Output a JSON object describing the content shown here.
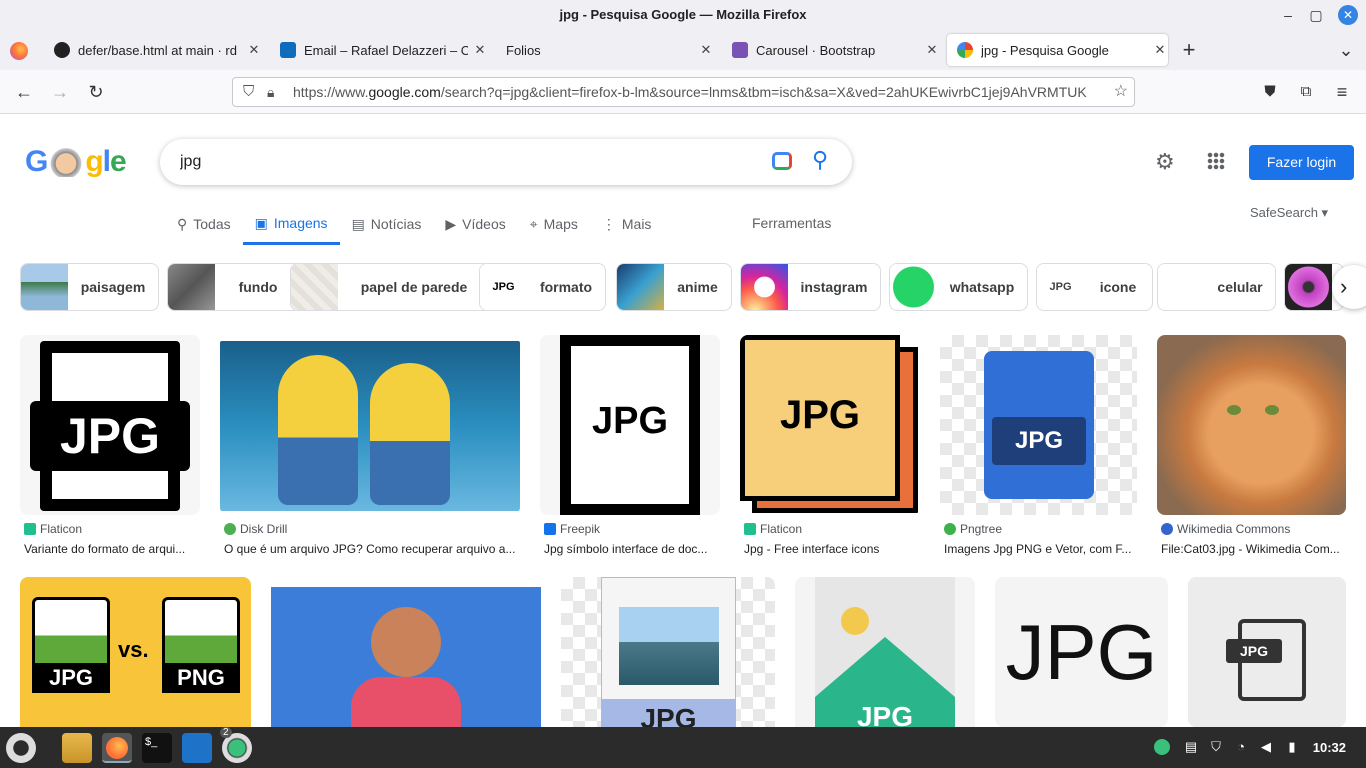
{
  "window": {
    "title": "jpg - Pesquisa Google — Mozilla Firefox",
    "minimize": "–",
    "maximize": "▢",
    "close": "✕"
  },
  "tabs": [
    {
      "label": "defer/base.html at main · rd",
      "icon": "github-icon",
      "close": "✕"
    },
    {
      "label": "Email – Rafael Delazzeri – O",
      "icon": "outlook-icon",
      "close": "✕"
    },
    {
      "label": "Folios",
      "icon": "",
      "close": "✕"
    },
    {
      "label": "Carousel · Bootstrap",
      "icon": "bootstrap-icon",
      "close": "✕"
    },
    {
      "label": "jpg - Pesquisa Google",
      "icon": "google-icon",
      "close": "✕"
    }
  ],
  "nav": {
    "new_tab": "+",
    "tab_list": "⌄",
    "back": "←",
    "forward": "→",
    "reload": "↻",
    "menu": "≡",
    "url_prefix": "https://www.",
    "url_host": "google.com",
    "url_rest": "/search?q=jpg&client=firefox-b-lm&source=lnms&tbm=isch&sa=X&ved=2ahUKEwivrbC1jej9AhVRMTUK"
  },
  "google": {
    "logo": "Google",
    "query": "jpg",
    "login": "Fazer login",
    "safesearch": "SafeSearch ▾",
    "tools": "Ferramentas",
    "tabs": [
      {
        "label": "Todas",
        "icon": "search-icon",
        "glyph": "⚲"
      },
      {
        "label": "Imagens",
        "icon": "image-icon",
        "glyph": "▣"
      },
      {
        "label": "Notícias",
        "icon": "news-icon",
        "glyph": "▤"
      },
      {
        "label": "Vídeos",
        "icon": "video-icon",
        "glyph": "▶"
      },
      {
        "label": "Maps",
        "icon": "map-pin-icon",
        "glyph": "⌖"
      },
      {
        "label": "Mais",
        "icon": "more-icon",
        "glyph": "⋮"
      }
    ],
    "chips": [
      "paisagem",
      "fundo",
      "papel de parede",
      "formato",
      "anime",
      "instagram",
      "whatsapp",
      "icone",
      "celular"
    ],
    "chip_next": "›",
    "results": [
      {
        "source": "Flaticon",
        "title": "Variante do formato de arqui...",
        "img_text": "JPG"
      },
      {
        "source": "Disk Drill",
        "title": "O que é um arquivo JPG? Como recuperar arquivo a...",
        "img_text": ""
      },
      {
        "source": "Freepik",
        "title": "Jpg símbolo interface de doc...",
        "img_text": "JPG"
      },
      {
        "source": "Flaticon",
        "title": "Jpg - Free interface icons",
        "img_text": "JPG"
      },
      {
        "source": "Pngtree",
        "title": "Imagens Jpg PNG e Vetor, com F...",
        "img_text": "JPG"
      },
      {
        "source": "Wikimedia Commons",
        "title": "File:Cat03.jpg - Wikimedia Com...",
        "img_text": ""
      }
    ],
    "row2": [
      {
        "t1": "JPG",
        "t2": "vs.",
        "t3": "PNG"
      },
      {
        "t1": ""
      },
      {
        "t1": "JPG"
      },
      {
        "t1": "JPG"
      },
      {
        "t1": "JPG"
      },
      {
        "t1": "JPG"
      }
    ]
  },
  "taskbar": {
    "clock": "10:32",
    "badge": "2"
  },
  "colors": {
    "accent": "#1a73e8",
    "taskbar": "#2b2b2b",
    "firefox": "#ff7139"
  }
}
